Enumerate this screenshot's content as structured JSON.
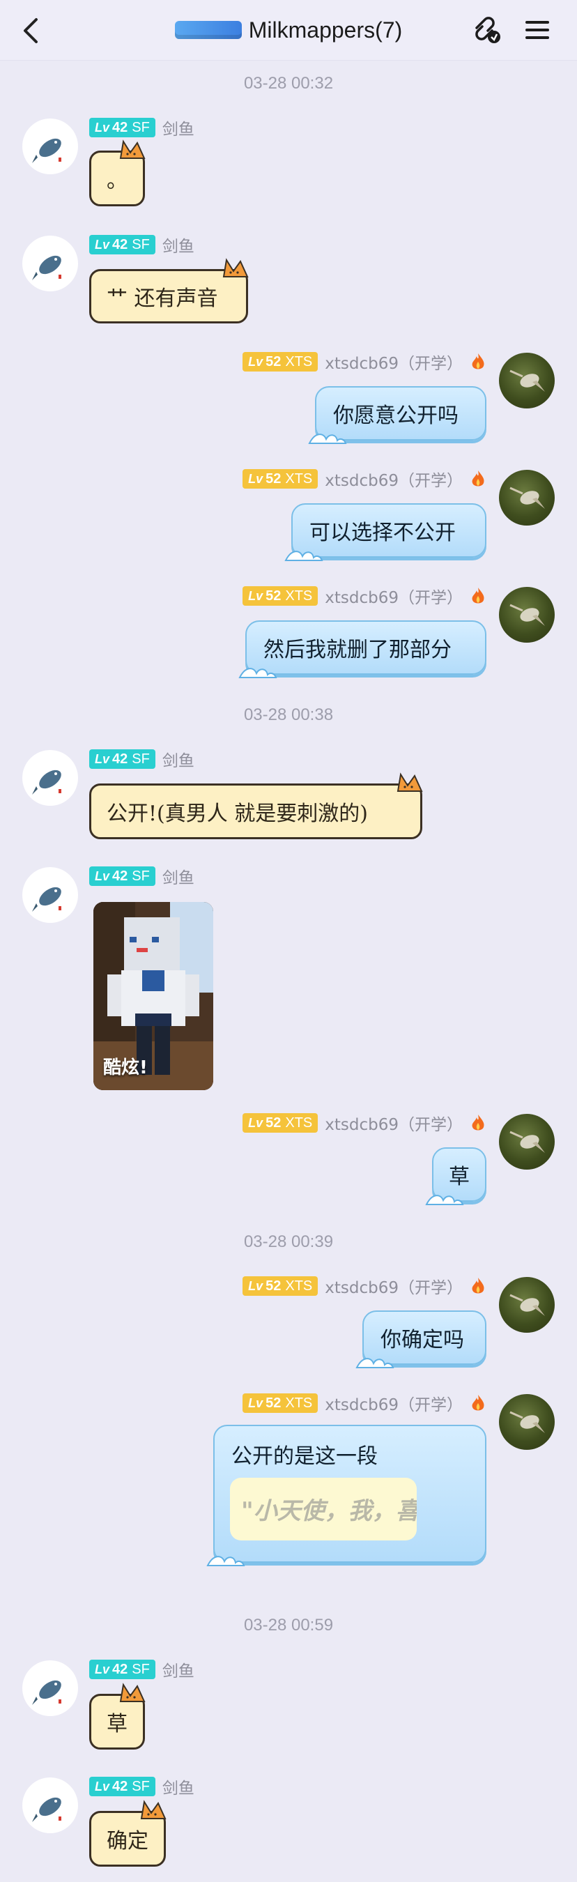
{
  "header": {
    "title": "Milkmappers(7)",
    "icons": [
      "back-icon",
      "group-logo",
      "link-icon",
      "menu-icon"
    ]
  },
  "users": {
    "left": {
      "level_prefix": "Lv",
      "level": "42",
      "tag": "SF",
      "name": "剑鱼",
      "avatar": "swordfish-avatar",
      "badge_color": "#29cfd0"
    },
    "right": {
      "level_prefix": "Lv",
      "level": "52",
      "tag": "XTS",
      "name": "xtsdcb69（开学）",
      "avatar": "hummingbird-avatar",
      "badge_color": "#f5c33b",
      "status_icon": "fire-icon"
    }
  },
  "timestamps": [
    "03-28 00:32",
    "03-28 00:38",
    "03-28 00:39",
    "03-28 00:59"
  ],
  "messages": [
    {
      "side": "left",
      "text": "。"
    },
    {
      "side": "left",
      "text": "艹 还有声音"
    },
    {
      "side": "right",
      "text": "你愿意公开吗"
    },
    {
      "side": "right",
      "text": "可以选择不公开"
    },
    {
      "side": "right",
      "text": "然后我就删了那部分"
    },
    {
      "side": "left",
      "text": "公开!(真男人 就是要刺激的)"
    },
    {
      "side": "left",
      "type": "image",
      "caption": "酷炫!"
    },
    {
      "side": "right",
      "text": "草"
    },
    {
      "side": "right",
      "text": "你确定吗"
    },
    {
      "side": "right",
      "text": "公开的是这一段",
      "quote": "\"小天使，我，喜"
    },
    {
      "side": "left",
      "text": "草"
    },
    {
      "side": "left",
      "text": "确定"
    }
  ],
  "colors": {
    "background": "#ebeaf5",
    "cat_bubble": "#fdf0c4",
    "wave_bubble": "#b3dcfa"
  }
}
